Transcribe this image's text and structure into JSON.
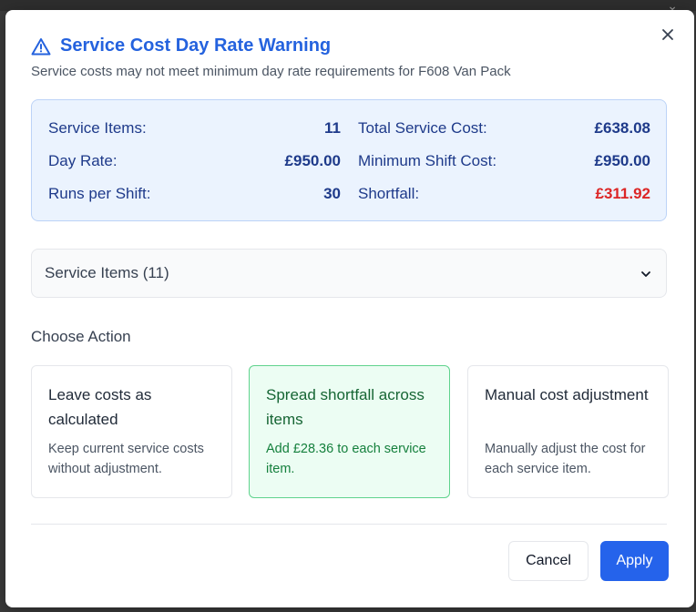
{
  "dialog": {
    "title": "Service Cost Day Rate Warning",
    "subtitle": "Service costs may not meet minimum day rate requirements for F608 Van Pack"
  },
  "summary": {
    "rows": [
      {
        "left_label": "Service Items:",
        "left_value": "11",
        "right_label": "Total Service Cost:",
        "right_value": "£638.08"
      },
      {
        "left_label": "Day Rate:",
        "left_value": "£950.00",
        "right_label": "Minimum Shift Cost:",
        "right_value": "£950.00"
      },
      {
        "left_label": "Runs per Shift:",
        "left_value": "30",
        "right_label": "Shortfall:",
        "right_value": "£311.92"
      }
    ]
  },
  "accordion": {
    "label": "Service Items (11)"
  },
  "actions": {
    "heading": "Choose Action",
    "options": [
      {
        "title": "Leave costs as calculated",
        "description": "Keep current service costs without adjustment.",
        "selected": false
      },
      {
        "title": "Spread shortfall across items",
        "description": "Add £28.36 to each service item.",
        "selected": true
      },
      {
        "title": "Manual cost adjustment",
        "description": "Manually adjust the cost for each service item.",
        "selected": false
      }
    ]
  },
  "footer": {
    "cancel_label": "Cancel",
    "apply_label": "Apply"
  },
  "colors": {
    "title": "#2462de",
    "summary_bg": "#ebf3fe",
    "summary_text": "#1e3a8a",
    "shortfall": "#dc2626",
    "selected_bg": "#ecfdf3",
    "selected_border": "#5fd38d",
    "apply_button": "#2563eb"
  },
  "icons": {
    "title": "warning-triangle-icon",
    "close": "close-icon",
    "accordion": "chevron-down-icon"
  }
}
